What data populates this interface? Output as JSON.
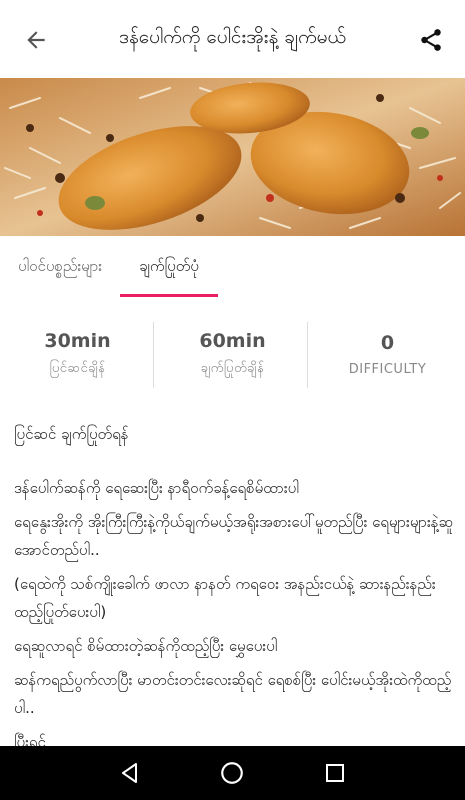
{
  "header": {
    "title": "ဒန်ပေါက်ကို ပေါင်းအိုးနဲ့ ချက်မယ်",
    "back_icon": "arrow-left-icon",
    "share_icon": "share-icon"
  },
  "hero": {
    "image": "chicken-biryani-photo"
  },
  "tabs": [
    {
      "label": "ပါဝင်ပစ္စည်းများ",
      "selected": false
    },
    {
      "label": "ချက်ပြုတ်ပုံ",
      "selected": true
    }
  ],
  "accent_color": "#e91e63",
  "stats": [
    {
      "value": "30min",
      "label": "ပြင်ဆင်ချိန်"
    },
    {
      "value": "60min",
      "label": "ချက်ပြုတ်ချိန်"
    },
    {
      "value": "0",
      "label": "DIFFICULTY"
    }
  ],
  "instructions": {
    "heading": "ပြင်ဆင် ချက်ပြုတ်ရန်",
    "paragraphs": [
      "ဒန်ပေါက်ဆန်ကို ရေဆေးပြီး နာရီဝက်ခန့်ရေစိမ်ထားပါ",
      "ရေနွေးအိုးကို အိုးကြီးကြီးနဲ့ကိုယ်ချက်မယ့်အရိုးအစားပေါ်မူတည်ပြီး ရေများများနဲ့ဆူအောင်တည်ပါ..",
      "(ရေထဲကို သစ်ကျိုးခေါက် ဖာလာ နာနတ် ကရဝေး အနည်းငယ်နဲ့ ဆားနည်းနည်းထည့်ပြုတ်ပေးပါ)",
      "ရေဆူလာရင် စိမ်ထားတဲ့ဆန်ကိုထည့်ပြီး မွှေပေးပါ",
      "ဆန်ကရည်ပွက်လာပြီး မာတင်းတင်းလေးဆိုရင် ရေစစ်ပြီး ပေါင်းမယ့်အိုးထဲကိုထည့်ပါ..",
      "ပြီးရင်"
    ]
  },
  "navbar": {
    "back_icon": "nav-back-icon",
    "home_icon": "nav-home-icon",
    "recents_icon": "nav-recents-icon"
  }
}
